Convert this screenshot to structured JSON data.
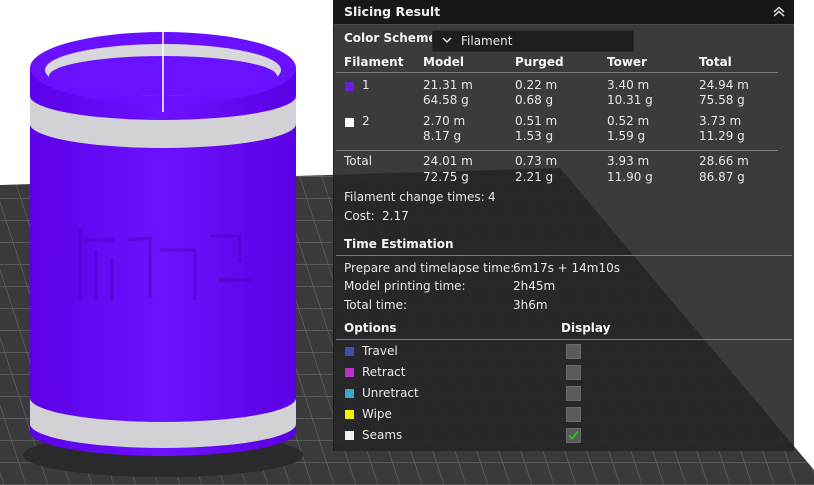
{
  "panel": {
    "title": "Slicing Result"
  },
  "color_scheme": {
    "label": "Color Scheme",
    "value": "Filament"
  },
  "table": {
    "headers": [
      "Filament",
      "Model",
      "Purged",
      "Tower",
      "Total"
    ],
    "rows": [
      {
        "id": "1",
        "color": "#6a1fe0",
        "model": [
          "21.31 m",
          "64.58 g"
        ],
        "purged": [
          "0.22 m",
          "0.68 g"
        ],
        "tower": [
          "3.40 m",
          "10.31 g"
        ],
        "total": [
          "24.94 m",
          "75.58 g"
        ]
      },
      {
        "id": "2",
        "color": "#ffffff",
        "model": [
          "2.70 m",
          "8.17 g"
        ],
        "purged": [
          "0.51 m",
          "1.53 g"
        ],
        "tower": [
          "0.52 m",
          "1.59 g"
        ],
        "total": [
          "3.73 m",
          "11.29 g"
        ]
      }
    ],
    "total_row": {
      "label": "Total",
      "model": [
        "24.01 m",
        "72.75 g"
      ],
      "purged": [
        "0.73 m",
        "2.21 g"
      ],
      "tower": [
        "3.93 m",
        "11.90 g"
      ],
      "total": [
        "28.66 m",
        "86.87 g"
      ]
    }
  },
  "filament_change": {
    "label": "Filament change times:",
    "value": "4"
  },
  "cost": {
    "label": "Cost:",
    "value": "2.17"
  },
  "time_estimation": {
    "title": "Time Estimation",
    "rows": [
      {
        "label": "Prepare and timelapse time:",
        "value": "6m17s + 14m10s"
      },
      {
        "label": "Model printing time:",
        "value": "2h45m"
      },
      {
        "label": "Total time:",
        "value": "3h6m"
      }
    ]
  },
  "options": {
    "title": "Options",
    "display_label": "Display",
    "items": [
      {
        "label": "Travel",
        "color": "#3a4fb0",
        "checked": false
      },
      {
        "label": "Retract",
        "color": "#c030c8",
        "checked": false
      },
      {
        "label": "Unretract",
        "color": "#36a8c8",
        "checked": false
      },
      {
        "label": "Wipe",
        "color": "#f2f200",
        "checked": false
      },
      {
        "label": "Seams",
        "color": "#f0f0f0",
        "checked": true
      }
    ]
  },
  "colors": {
    "model": "#6a0dff",
    "stripe": "#d2d2d6",
    "plate": "#3a3a3c",
    "grid": "#6a6a6c",
    "check": "#1ec51e"
  }
}
